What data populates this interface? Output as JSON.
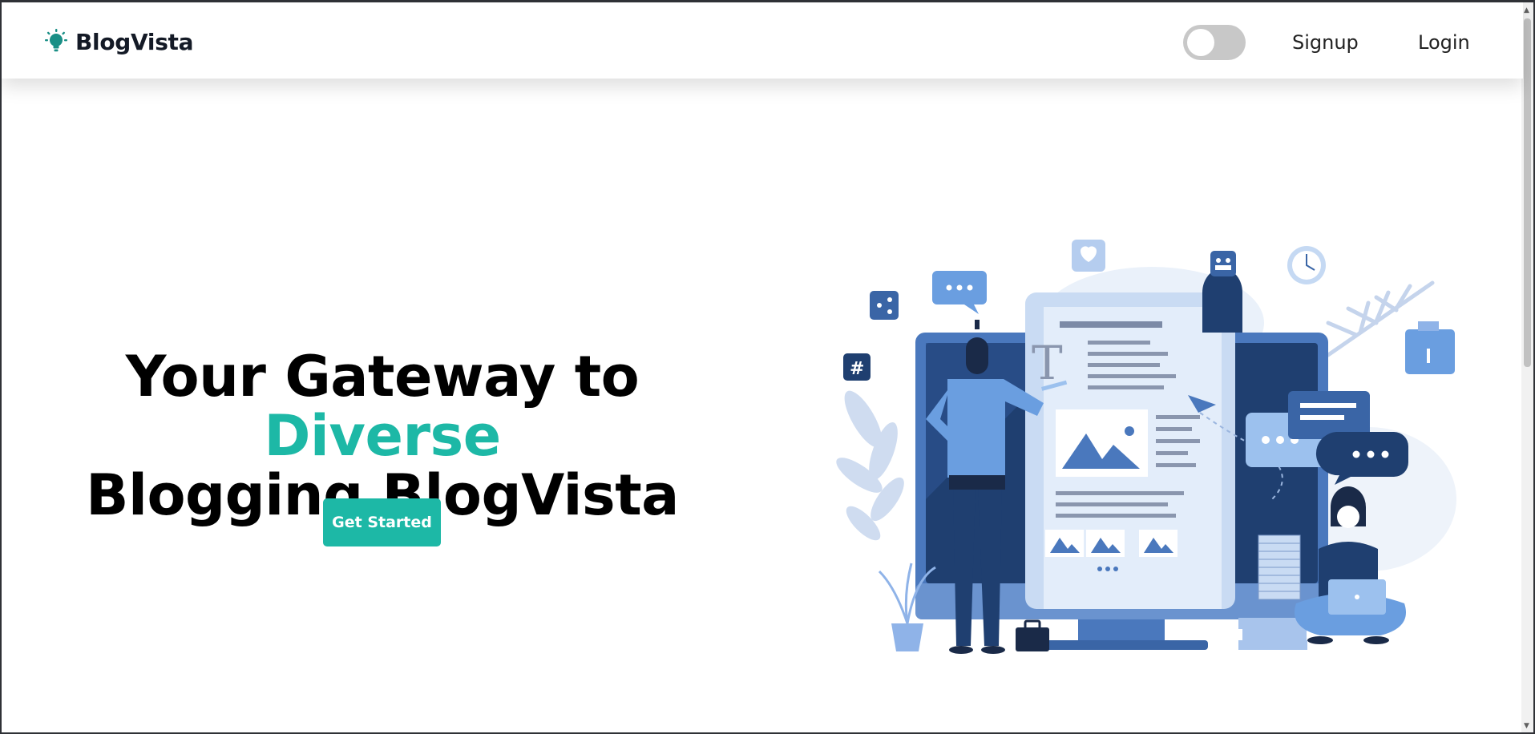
{
  "brand": {
    "name": "BlogVista",
    "icon": "lightbulb-icon",
    "icon_color": "#1db8a6"
  },
  "nav": {
    "theme_toggle": {
      "state": "off"
    },
    "signup_label": "Signup",
    "login_label": "Login"
  },
  "hero": {
    "title_part1": "Your Gateway to ",
    "title_highlight": "Diverse",
    "title_part2": "Blogging BlogVista",
    "cta_label": "Get Started",
    "illustration": "blogging-illustration"
  },
  "colors": {
    "accent": "#1db8a6",
    "illustration_primary": "#3d6db3",
    "illustration_dark": "#1e3e6e",
    "text": "#000000"
  }
}
